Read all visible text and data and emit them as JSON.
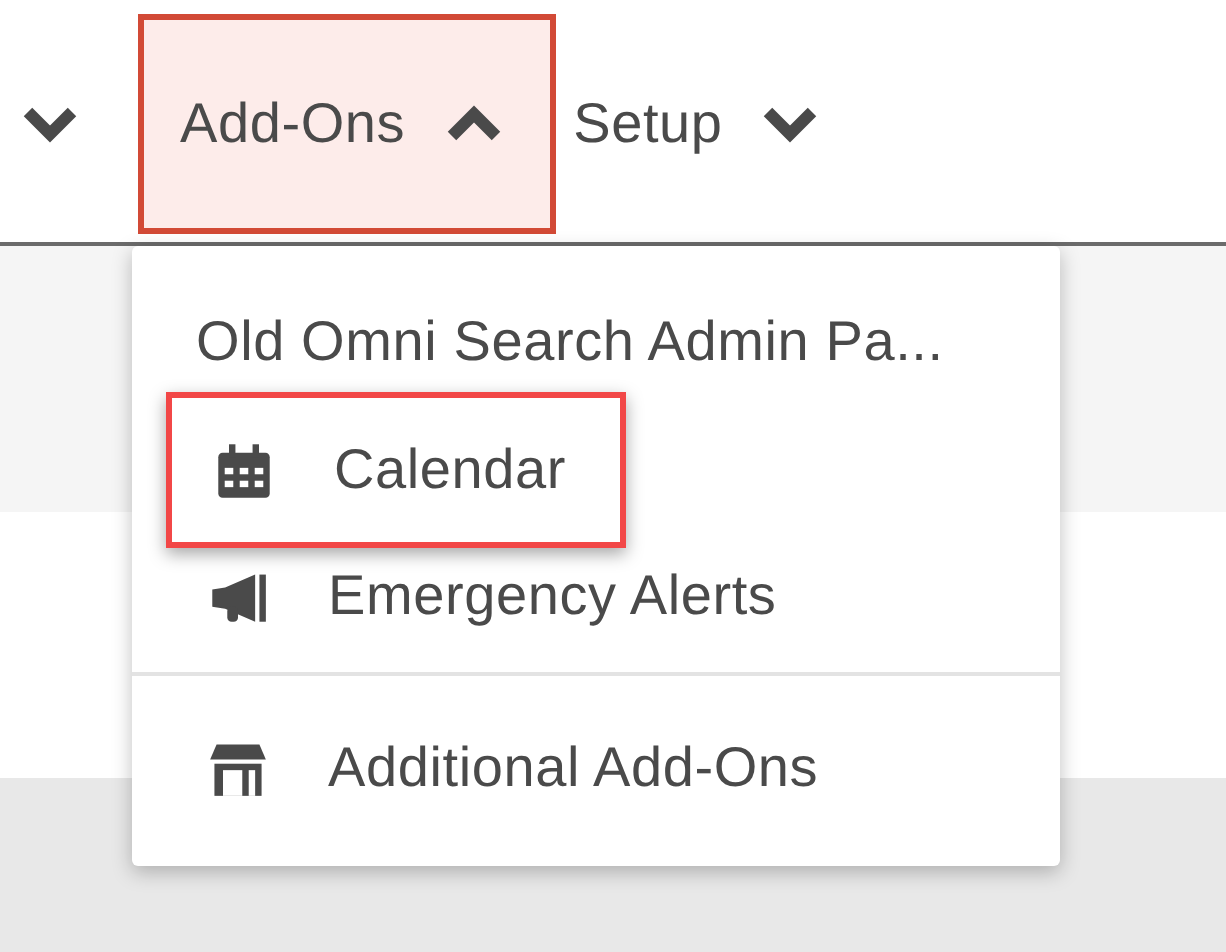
{
  "nav": {
    "tabs": [
      {
        "expanded": false
      },
      {
        "label": "Add-Ons",
        "expanded": true
      },
      {
        "label": "Setup",
        "expanded": false
      }
    ]
  },
  "dropdown": {
    "items": [
      {
        "kind": "item",
        "label": "Old Omni Search Admin Pa...",
        "highlighted": false
      },
      {
        "kind": "item",
        "label": "Calendar",
        "highlighted": true
      },
      {
        "kind": "item",
        "label": "Emergency Alerts",
        "highlighted": false
      },
      {
        "kind": "divider"
      },
      {
        "kind": "item",
        "label": "Additional Add-Ons",
        "highlighted": false
      }
    ]
  }
}
